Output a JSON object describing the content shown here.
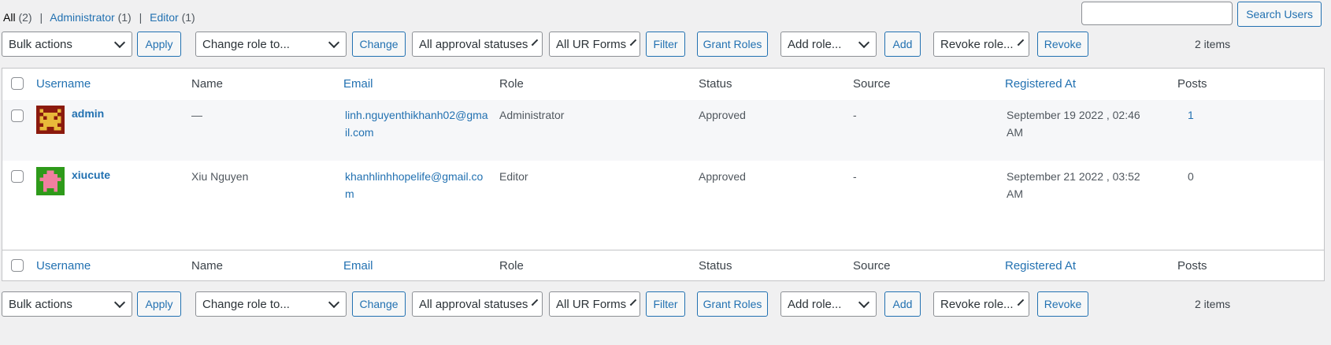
{
  "views": {
    "all_label": "All",
    "all_count": "(2)",
    "admin_label": "Administrator",
    "admin_count": "(1)",
    "editor_label": "Editor",
    "editor_count": "(1)",
    "separator": "|"
  },
  "search": {
    "value": "",
    "button_label": "Search Users"
  },
  "tablenav": {
    "bulk_actions": "Bulk actions",
    "apply": "Apply",
    "change_role_to": "Change role to...",
    "change": "Change",
    "approval_status": "All approval statuses",
    "ur_forms": "All UR Forms",
    "filter": "Filter",
    "grant_roles": "Grant Roles",
    "add_role": "Add role...",
    "add": "Add",
    "revoke_role": "Revoke role...",
    "revoke": "Revoke",
    "items_count": "2 items"
  },
  "columns": {
    "username": "Username",
    "name": "Name",
    "email": "Email",
    "role": "Role",
    "status": "Status",
    "source": "Source",
    "registered_at": "Registered At",
    "posts": "Posts"
  },
  "rows": [
    {
      "username": "admin",
      "name": "—",
      "email_line1": "linh.nguyenthikhanh02@gma",
      "email_line2": "il.com",
      "role": "Administrator",
      "status": "Approved",
      "source": "-",
      "registered_line1": "September 19 2022 , 02:46",
      "registered_line2": "AM",
      "posts": "1",
      "avatar_icon": "identicon-red-icon"
    },
    {
      "username": "xiucute",
      "name": "Xiu Nguyen",
      "email_line1": "khanhlinhhopelife@gmail.co",
      "email_line2": "m",
      "role": "Editor",
      "status": "Approved",
      "source": "-",
      "registered_line1": "September 21 2022 , 03:52",
      "registered_line2": "AM",
      "posts": "0",
      "avatar_icon": "identicon-green-icon"
    }
  ],
  "colors": {
    "link": "#2271b1",
    "background": "#f0f0f1"
  }
}
